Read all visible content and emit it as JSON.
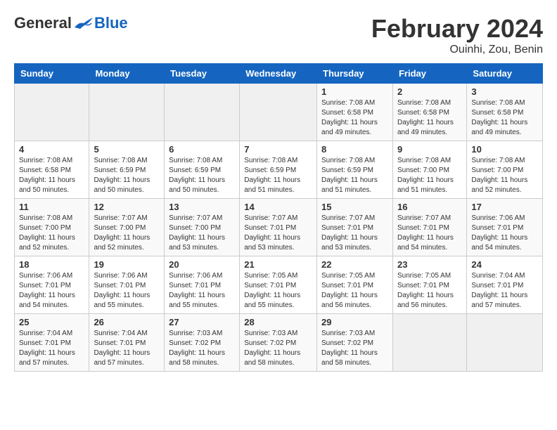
{
  "header": {
    "logo_general": "General",
    "logo_blue": "Blue",
    "month_title": "February 2024",
    "location": "Ouinhi, Zou, Benin"
  },
  "days_of_week": [
    "Sunday",
    "Monday",
    "Tuesday",
    "Wednesday",
    "Thursday",
    "Friday",
    "Saturday"
  ],
  "weeks": [
    [
      {
        "day": "",
        "info": ""
      },
      {
        "day": "",
        "info": ""
      },
      {
        "day": "",
        "info": ""
      },
      {
        "day": "",
        "info": ""
      },
      {
        "day": "1",
        "info": "Sunrise: 7:08 AM\nSunset: 6:58 PM\nDaylight: 11 hours\nand 49 minutes."
      },
      {
        "day": "2",
        "info": "Sunrise: 7:08 AM\nSunset: 6:58 PM\nDaylight: 11 hours\nand 49 minutes."
      },
      {
        "day": "3",
        "info": "Sunrise: 7:08 AM\nSunset: 6:58 PM\nDaylight: 11 hours\nand 49 minutes."
      }
    ],
    [
      {
        "day": "4",
        "info": "Sunrise: 7:08 AM\nSunset: 6:58 PM\nDaylight: 11 hours\nand 50 minutes."
      },
      {
        "day": "5",
        "info": "Sunrise: 7:08 AM\nSunset: 6:59 PM\nDaylight: 11 hours\nand 50 minutes."
      },
      {
        "day": "6",
        "info": "Sunrise: 7:08 AM\nSunset: 6:59 PM\nDaylight: 11 hours\nand 50 minutes."
      },
      {
        "day": "7",
        "info": "Sunrise: 7:08 AM\nSunset: 6:59 PM\nDaylight: 11 hours\nand 51 minutes."
      },
      {
        "day": "8",
        "info": "Sunrise: 7:08 AM\nSunset: 6:59 PM\nDaylight: 11 hours\nand 51 minutes."
      },
      {
        "day": "9",
        "info": "Sunrise: 7:08 AM\nSunset: 7:00 PM\nDaylight: 11 hours\nand 51 minutes."
      },
      {
        "day": "10",
        "info": "Sunrise: 7:08 AM\nSunset: 7:00 PM\nDaylight: 11 hours\nand 52 minutes."
      }
    ],
    [
      {
        "day": "11",
        "info": "Sunrise: 7:08 AM\nSunset: 7:00 PM\nDaylight: 11 hours\nand 52 minutes."
      },
      {
        "day": "12",
        "info": "Sunrise: 7:07 AM\nSunset: 7:00 PM\nDaylight: 11 hours\nand 52 minutes."
      },
      {
        "day": "13",
        "info": "Sunrise: 7:07 AM\nSunset: 7:00 PM\nDaylight: 11 hours\nand 53 minutes."
      },
      {
        "day": "14",
        "info": "Sunrise: 7:07 AM\nSunset: 7:01 PM\nDaylight: 11 hours\nand 53 minutes."
      },
      {
        "day": "15",
        "info": "Sunrise: 7:07 AM\nSunset: 7:01 PM\nDaylight: 11 hours\nand 53 minutes."
      },
      {
        "day": "16",
        "info": "Sunrise: 7:07 AM\nSunset: 7:01 PM\nDaylight: 11 hours\nand 54 minutes."
      },
      {
        "day": "17",
        "info": "Sunrise: 7:06 AM\nSunset: 7:01 PM\nDaylight: 11 hours\nand 54 minutes."
      }
    ],
    [
      {
        "day": "18",
        "info": "Sunrise: 7:06 AM\nSunset: 7:01 PM\nDaylight: 11 hours\nand 54 minutes."
      },
      {
        "day": "19",
        "info": "Sunrise: 7:06 AM\nSunset: 7:01 PM\nDaylight: 11 hours\nand 55 minutes."
      },
      {
        "day": "20",
        "info": "Sunrise: 7:06 AM\nSunset: 7:01 PM\nDaylight: 11 hours\nand 55 minutes."
      },
      {
        "day": "21",
        "info": "Sunrise: 7:05 AM\nSunset: 7:01 PM\nDaylight: 11 hours\nand 55 minutes."
      },
      {
        "day": "22",
        "info": "Sunrise: 7:05 AM\nSunset: 7:01 PM\nDaylight: 11 hours\nand 56 minutes."
      },
      {
        "day": "23",
        "info": "Sunrise: 7:05 AM\nSunset: 7:01 PM\nDaylight: 11 hours\nand 56 minutes."
      },
      {
        "day": "24",
        "info": "Sunrise: 7:04 AM\nSunset: 7:01 PM\nDaylight: 11 hours\nand 57 minutes."
      }
    ],
    [
      {
        "day": "25",
        "info": "Sunrise: 7:04 AM\nSunset: 7:01 PM\nDaylight: 11 hours\nand 57 minutes."
      },
      {
        "day": "26",
        "info": "Sunrise: 7:04 AM\nSunset: 7:01 PM\nDaylight: 11 hours\nand 57 minutes."
      },
      {
        "day": "27",
        "info": "Sunrise: 7:03 AM\nSunset: 7:02 PM\nDaylight: 11 hours\nand 58 minutes."
      },
      {
        "day": "28",
        "info": "Sunrise: 7:03 AM\nSunset: 7:02 PM\nDaylight: 11 hours\nand 58 minutes."
      },
      {
        "day": "29",
        "info": "Sunrise: 7:03 AM\nSunset: 7:02 PM\nDaylight: 11 hours\nand 58 minutes."
      },
      {
        "day": "",
        "info": ""
      },
      {
        "day": "",
        "info": ""
      }
    ]
  ]
}
